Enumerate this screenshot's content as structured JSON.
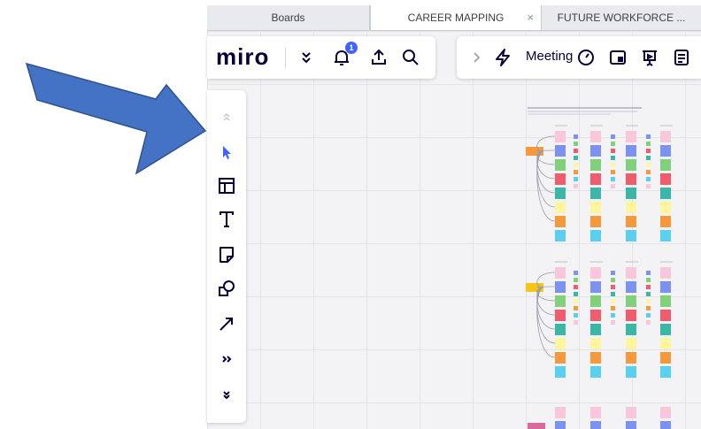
{
  "tabs": [
    {
      "label": "Boards"
    },
    {
      "label": "CAREER MAPPING",
      "close": "×"
    },
    {
      "label": "FUTURE WORKFORCE ..."
    }
  ],
  "toolbar": {
    "logo": "miro",
    "notification_count": "1",
    "meeting_label": "Meeting"
  },
  "colors": {
    "arrow_fill": "#4472c4",
    "arrow_stroke": "#2f528f",
    "accent": "#4262ff",
    "sticky_pink": "#f9c6dc",
    "sticky_blue": "#7b92f2",
    "sticky_green": "#7fd17a",
    "sticky_red": "#f05c6c",
    "sticky_teal": "#39b8a8",
    "sticky_yellow": "#fff59d",
    "sticky_orange": "#f59a3c",
    "sticky_cyan": "#5ad0f0"
  },
  "icons": {
    "left_toolbar": [
      "chevron-up-double-icon",
      "select-cursor-icon",
      "template-icon",
      "text-icon",
      "sticky-note-icon",
      "shapes-icon",
      "arrow-line-icon",
      "more-tools-icon",
      "chevron-down-double-icon"
    ],
    "top_left": [
      "chevron-down-double-icon",
      "bell-icon",
      "upload-icon",
      "search-icon"
    ],
    "top_right": [
      "chevron-right-icon",
      "lightning-icon",
      "timer-icon",
      "voting-icon",
      "present-icon",
      "notes-icon"
    ]
  }
}
